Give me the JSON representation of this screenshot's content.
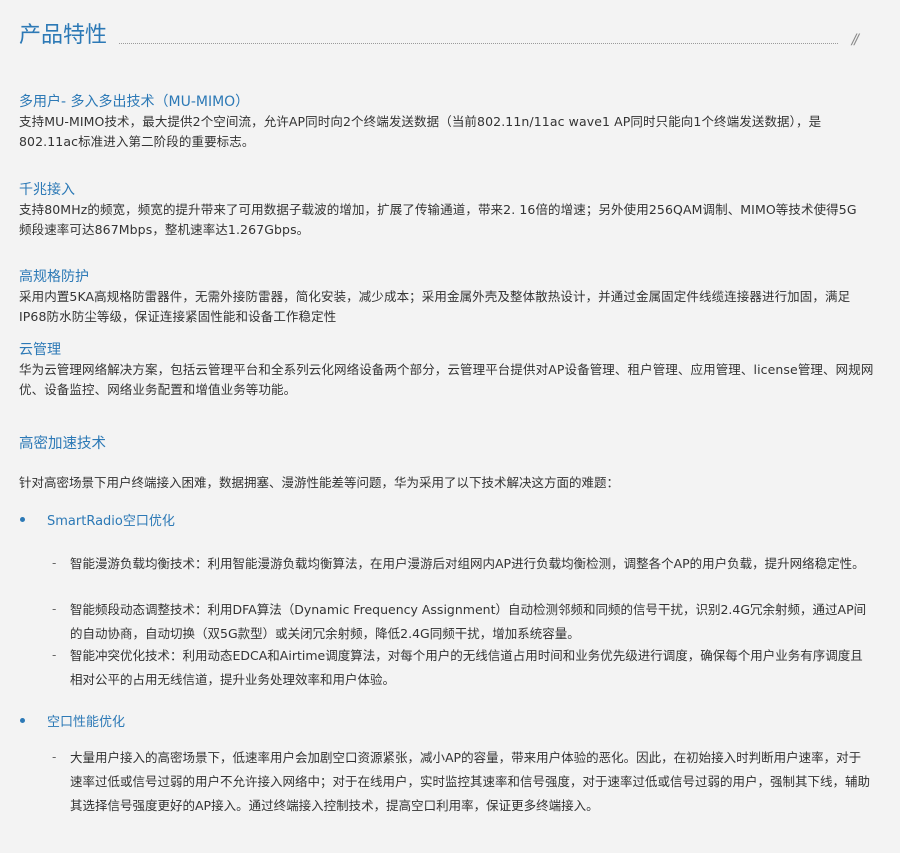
{
  "header": {
    "title": "产品特性",
    "decoration": "//"
  },
  "sections": [
    {
      "title": "多用户- 多入多出技术（MU-MIMO）",
      "body": "支持MU-MIMO技术，最大提供2个空间流，允许AP同时向2个终端发送数据（当前802.11n/11ac wave1 AP同时只能向1个终端发送数据），是802.11ac标准进入第二阶段的重要标志。"
    },
    {
      "title": "千兆接入",
      "body": "支持80MHz的频宽，频宽的提升带来了可用数据子载波的增加，扩展了传输通道，带来2. 16倍的增速；另外使用256QAM调制、MIMO等技术使得5G 频段速率可达867Mbps，整机速率达1.267Gbps。"
    },
    {
      "title": "高规格防护",
      "body": "采用内置5KA高规格防雷器件，无需外接防雷器，简化安装，减少成本；采用金属外壳及整体散热设计，并通过金属固定件线缆连接器进行加固，满足IP68防水防尘等级，保证连接紧固性能和设备工作稳定性"
    },
    {
      "title": "云管理",
      "body": "华为云管理网络解决方案，包括云管理平台和全系列云化网络设备两个部分，云管理平台提供对AP设备管理、租户管理、应用管理、license管理、网规网优、设备监控、网络业务配置和增值业务等功能。"
    }
  ],
  "dense": {
    "title": "高密加速技术",
    "intro": "针对高密场景下用户终端接入困难，数据拥塞、漫游性能差等问题，华为采用了以下技术解决这方面的难题：",
    "bullets": [
      {
        "label": "SmartRadio空口优化",
        "items": [
          "智能漫游负载均衡技术：利用智能漫游负载均衡算法，在用户漫游后对组网内AP进行负载均衡检测，调整各个AP的用户负载，提升网络稳定性。",
          "智能频段动态调整技术：利用DFA算法（Dynamic Frequency Assignment）自动检测邻频和同频的信号干扰，识别2.4G冗余射频，通过AP间的自动协商，自动切换（双5G款型）或关闭冗余射频，降低2.4G同频干扰，增加系统容量。",
          "智能冲突优化技术：利用动态EDCA和Airtime调度算法，对每个用户的无线信道占用时间和业务优先级进行调度，确保每个用户业务有序调度且相对公平的占用无线信道，提升业务处理效率和用户体验。"
        ]
      },
      {
        "label": "空口性能优化",
        "items": [
          "大量用户接入的高密场景下，低速率用户会加剧空口资源紧张，减小AP的容量，带来用户体验的恶化。因此，在初始接入时判断用户速率，对于速率过低或信号过弱的用户不允许接入网络中；对于在线用户，实时监控其速率和信号强度，对于速率过低或信号过弱的用户，强制其下线，辅助其选择信号强度更好的AP接入。通过终端接入控制技术，提高空口利用率，保证更多终端接入。"
        ]
      }
    ]
  },
  "colors": {
    "accent": "#2c79b6",
    "text": "#333333",
    "background": "#f3f3f3"
  }
}
